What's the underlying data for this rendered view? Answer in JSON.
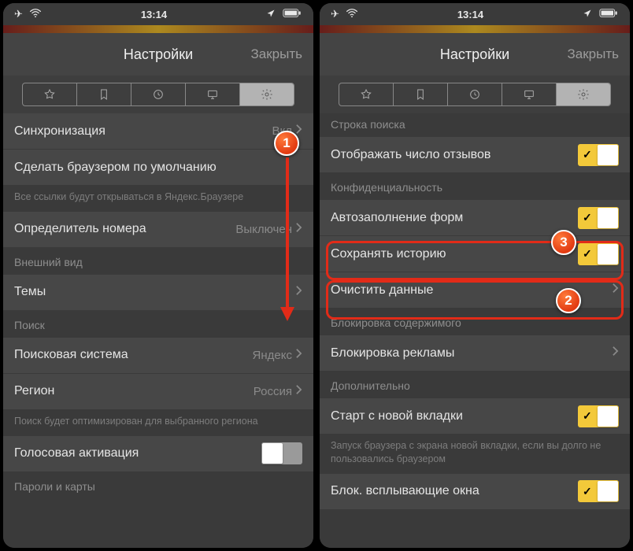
{
  "status": {
    "time": "13:14"
  },
  "nav": {
    "title": "Настройки",
    "close": "Закрыть"
  },
  "left": {
    "sync_label": "Синхронизация",
    "sync_value": "Вкл",
    "default_browser": "Сделать браузером по умолчанию",
    "default_browser_note": "Все ссылки будут открываться в Яндекс.Браузере",
    "caller_id_label": "Определитель номера",
    "caller_id_value": "Выключен",
    "appearance_header": "Внешний вид",
    "themes": "Темы",
    "search_header": "Поиск",
    "search_engine_label": "Поисковая система",
    "search_engine_value": "Яндекс",
    "region_label": "Регион",
    "region_value": "Россия",
    "region_note": "Поиск будет оптимизирован для выбранного региона",
    "voice": "Голосовая активация",
    "passwords_header": "Пароли и карты"
  },
  "right": {
    "searchbar_header": "Строка поиска",
    "reviews": "Отображать число отзывов",
    "privacy_header": "Конфиденциальность",
    "autofill": "Автозаполнение форм",
    "save_history": "Сохранять историю",
    "clear_data": "Очистить данные",
    "block_header": "Блокировка содержимого",
    "adblock": "Блокировка рекламы",
    "extra_header": "Дополнительно",
    "start_new_tab": "Старт с новой вкладки",
    "start_note": "Запуск браузера с экрана новой вкладки, если вы долго не пользовались браузером",
    "block_popups": "Блок. всплывающие окна"
  },
  "callouts": {
    "one": "1",
    "two": "2",
    "three": "3"
  }
}
